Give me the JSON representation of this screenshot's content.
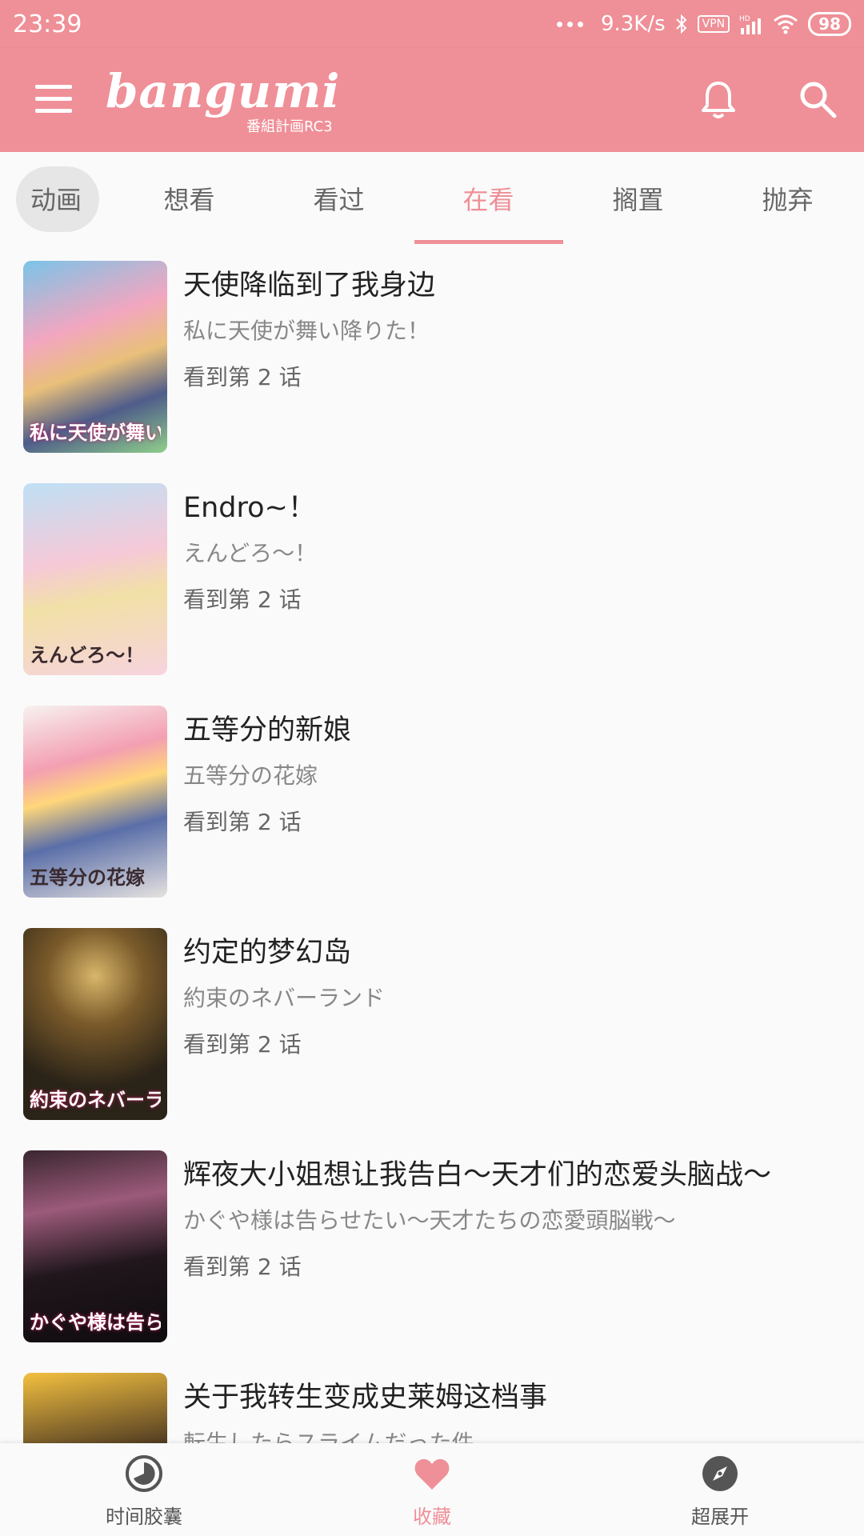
{
  "status_bar": {
    "time": "23:39",
    "net_speed": "9.3K/s",
    "vpn": "VPN",
    "hd": "HD",
    "battery": "98"
  },
  "app_bar": {
    "logo": "bangumi",
    "logo_sub": "番組計画RC3",
    "icons": [
      "menu-icon",
      "bell-icon",
      "search-icon"
    ]
  },
  "tabs": [
    "动画",
    "想看",
    "看过",
    "在看",
    "搁置",
    "抛弃"
  ],
  "active_tab": "在看",
  "items": [
    {
      "title": "天使降临到了我身边",
      "subtitle": "私に天使が舞い降りた！",
      "progress": "看到第 2 话",
      "cover_text": "私に天使が舞い降りた！"
    },
    {
      "title": "Endro~！",
      "subtitle": "えんどろ〜！",
      "progress": "看到第 2 话",
      "cover_text": "えんどろ〜！"
    },
    {
      "title": "五等分的新娘",
      "subtitle": "五等分の花嫁",
      "progress": "看到第 2 话",
      "cover_text": "五等分の花嫁"
    },
    {
      "title": "约定的梦幻岛",
      "subtitle": "約束のネバーランド",
      "progress": "看到第 2 话",
      "cover_text": "約束のネバーランド"
    },
    {
      "title": "辉夜大小姐想让我告白～天才们的恋爱头脑战～",
      "subtitle": "かぐや様は告らせたい～天才たちの恋愛頭脳戦～",
      "progress": "看到第 2 话",
      "cover_text": "かぐや様は告らせたい"
    },
    {
      "title": "关于我转生变成史莱姆这档事",
      "subtitle": "転生したらスライムだった件",
      "progress": "",
      "cover_text": ""
    }
  ],
  "bottom_nav": [
    {
      "label": "时间胶囊",
      "icon": "clock-icon"
    },
    {
      "label": "收藏",
      "icon": "heart-icon"
    },
    {
      "label": "超展开",
      "icon": "compass-icon"
    }
  ],
  "colors": {
    "accent": "#ef8f97",
    "text": "#222222",
    "subtext": "#888888"
  }
}
